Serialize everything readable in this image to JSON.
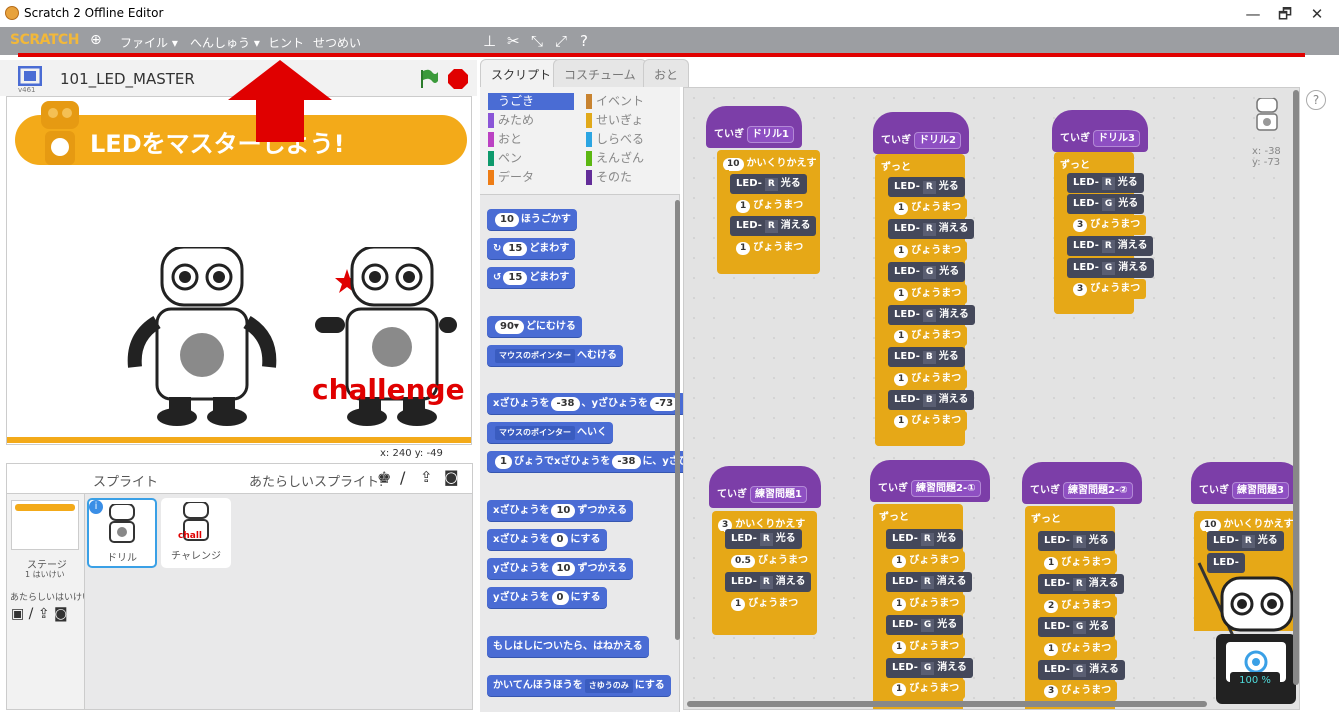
{
  "window": {
    "title": "Scratch 2 Offline Editor",
    "min": "—",
    "max": "🗗",
    "close": "✕"
  },
  "menu": {
    "logo": "SCRATCH",
    "file": "ファイル ▾",
    "edit": "へんしゅう ▾",
    "hint": "ヒント",
    "about": "せつめい"
  },
  "project": {
    "name": "101_LED_MASTER",
    "version": "v461"
  },
  "stage": {
    "banner": "LEDをマスターしよう!",
    "challenge": "challenge",
    "coords": "x: 240  y: -49"
  },
  "sprites": {
    "header": "スプライト",
    "new_sprite": "あたらしいスプライト:",
    "stage_label": "ステージ",
    "backdrop_count": "1 はいけい",
    "new_backdrop": "あたらしいはいけい",
    "items": [
      {
        "name": "ドリル"
      },
      {
        "name": "チャレンジ"
      }
    ]
  },
  "tabs": [
    "スクリプト",
    "コスチューム",
    "おと"
  ],
  "categories": [
    {
      "label": "うごき",
      "color": "#4a6cd4"
    },
    {
      "label": "イベント",
      "color": "#c88330"
    },
    {
      "label": "みため",
      "color": "#8a55d7"
    },
    {
      "label": "せいぎょ",
      "color": "#e1a91a"
    },
    {
      "label": "おと",
      "color": "#bb42c3"
    },
    {
      "label": "しらべる",
      "color": "#2ca5e2"
    },
    {
      "label": "ペン",
      "color": "#0e9a6c"
    },
    {
      "label": "えんざん",
      "color": "#5cb712"
    },
    {
      "label": "データ",
      "color": "#ee7d16"
    },
    {
      "label": "そのた",
      "color": "#632d99"
    }
  ],
  "palette": {
    "move": [
      "10",
      "ほうごかす"
    ],
    "turn_right": [
      "15",
      "どまわす"
    ],
    "turn_left": [
      "15",
      "どまわす"
    ],
    "point_dir": [
      "90▾",
      "どにむける"
    ],
    "point_towards": [
      "マウスのポインター",
      "へむける"
    ],
    "goto_xy": [
      "xざひょうを",
      "-38",
      "、yざひょうを",
      "-73"
    ],
    "goto": [
      "マウスのポインター",
      "へいく"
    ],
    "glide": [
      "1",
      "びょうでxざひょうを",
      "-38",
      "に、yざひ"
    ],
    "change_x": [
      "xざひょうを",
      "10",
      "ずつかえる"
    ],
    "set_x": [
      "xざひょうを",
      "0",
      "にする"
    ],
    "change_y": [
      "yざひょうを",
      "10",
      "ずつかえる"
    ],
    "set_y": [
      "yざひょうを",
      "0",
      "にする"
    ],
    "bounce": "もしはしについたら、はねかえる",
    "rotation": [
      "かいてんほうほうを",
      "さゆうのみ",
      "にする"
    ]
  },
  "scripts": {
    "drill1": {
      "hat": "ていぎ",
      "name": "ドリル1",
      "repeat": "10",
      "repeat_label": "かいくりかえす"
    },
    "drill2": {
      "hat": "ていぎ",
      "name": "ドリル2",
      "forever": "ずっと"
    },
    "drill3": {
      "hat": "ていぎ",
      "name": "ドリル3",
      "forever": "ずっと"
    },
    "ex1": {
      "hat": "ていぎ",
      "name": "練習問題1",
      "repeat": "3",
      "repeat_label": "かいくりかえす"
    },
    "ex2a": {
      "hat": "ていぎ",
      "name": "練習問題2-①",
      "forever": "ずっと"
    },
    "ex2b": {
      "hat": "ていぎ",
      "name": "練習問題2-②",
      "forever": "ずっと"
    },
    "ex3": {
      "hat": "ていぎ",
      "name": "練習問題3",
      "repeat": "10",
      "repeat_label": "かいくりかえす"
    },
    "led": "LED-",
    "on": "光る",
    "off": "消える",
    "wait": "びょうまつ",
    "r": "R",
    "g": "G",
    "b": "B",
    "one": "1",
    "two": "2",
    "three": "3",
    "half": "0.5"
  },
  "sprite_xy": {
    "x": "x: -38",
    "y": "y: -73"
  },
  "zoom": "100 %"
}
